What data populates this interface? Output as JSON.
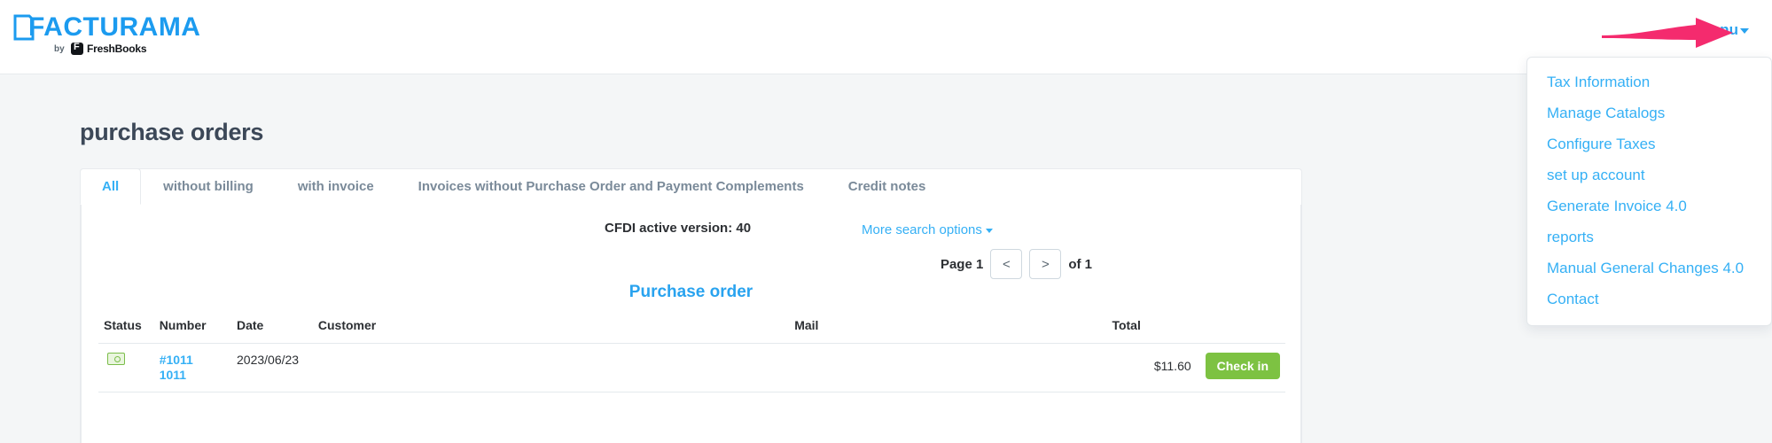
{
  "brand": {
    "name": "FACTURAMA",
    "by_label": "by",
    "partner": "FreshBooks",
    "accent_color": "#1c9bef"
  },
  "header": {
    "menu_label": "Menu",
    "menu_caret": "chevron-down-icon"
  },
  "annotation": {
    "type": "arrow",
    "color": "#f42b6e",
    "points_to": "Menu"
  },
  "dropdown": {
    "items": [
      {
        "label": "Tax Information"
      },
      {
        "label": "Manage Catalogs"
      },
      {
        "label": "Configure Taxes"
      },
      {
        "label": "set up account"
      },
      {
        "label": "Generate Invoice 4.0"
      },
      {
        "label": "reports"
      },
      {
        "label": "Manual General Changes 4.0"
      },
      {
        "label": "Contact"
      }
    ]
  },
  "page": {
    "title": "purchase orders"
  },
  "tabs": [
    {
      "label": "All",
      "active": true
    },
    {
      "label": "without billing",
      "active": false
    },
    {
      "label": "with invoice",
      "active": false
    },
    {
      "label": "Invoices without Purchase Order and Payment Complements",
      "active": false
    },
    {
      "label": "Credit notes",
      "active": false
    }
  ],
  "toolbar": {
    "cfdi_version": "CFDI active version: 40",
    "more_search_options": "More search options"
  },
  "pagination": {
    "page_label": "Page 1",
    "prev_label": "<",
    "next_label": ">",
    "of_label": "of 1"
  },
  "section": {
    "heading": "Purchase order"
  },
  "table": {
    "columns": {
      "status": "Status",
      "number": "Number",
      "date": "Date",
      "customer": "Customer",
      "mail": "Mail",
      "total": "Total"
    },
    "rows": [
      {
        "status_icon": "money-bill-icon",
        "number_primary": "#1011",
        "number_secondary": "1011",
        "date": "2023/06/23",
        "customer": "",
        "mail": "",
        "total": "$11.60",
        "action_label": "Check in",
        "action_color": "#7dc242"
      }
    ]
  }
}
